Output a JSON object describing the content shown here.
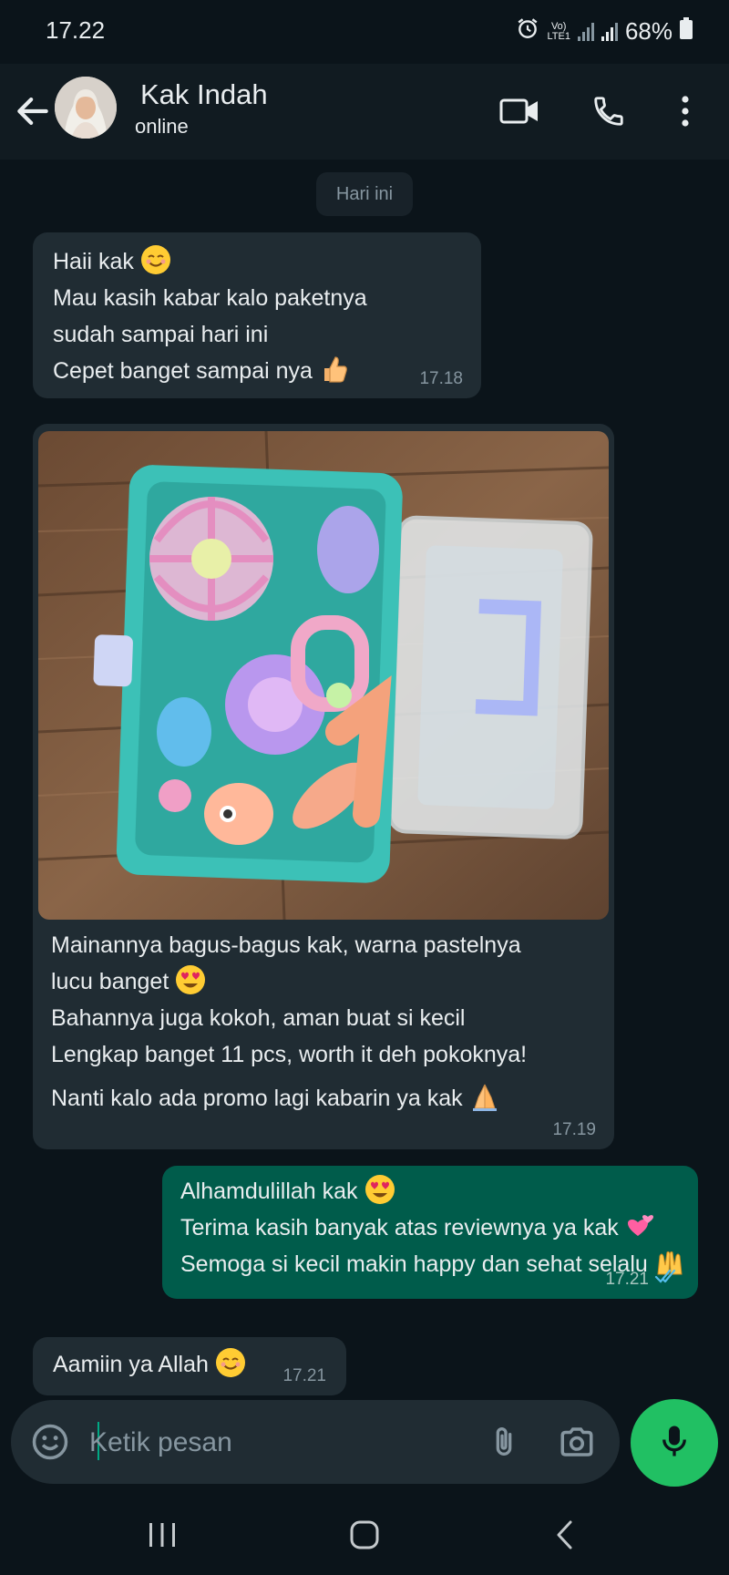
{
  "status_bar": {
    "time": "17.22",
    "network_top": "Vo)",
    "network_bottom": "LTE1",
    "battery": "68%",
    "icons": [
      "alarm-icon",
      "signal-icon",
      "signal-icon",
      "battery-icon"
    ]
  },
  "header": {
    "contact_name": "Kak Indah",
    "status": "online",
    "icons": [
      "back-arrow-icon",
      "avatar",
      "video-call-icon",
      "phone-icon",
      "more-vertical-icon"
    ]
  },
  "chat": {
    "date_chip": "Hari ini",
    "messages": [
      {
        "direction": "incoming",
        "lines": [
          "Haii kak",
          "Mau kasih kabar kalo paketnya",
          "sudah sampai hari ini",
          "Cepet banget sampai nya"
        ],
        "time": "17.18"
      },
      {
        "direction": "incoming",
        "has_photo": true,
        "lines": [
          "Mainannya bagus-bagus kak, warna pastelnya",
          "lucu banget",
          "Bahannya juga kokoh, aman buat si kecil",
          "Lengkap banget 11 pcs, worth it deh pokoknya!",
          "Nanti kalo ada promo lagi kabarin ya kak"
        ],
        "time": "17.19"
      },
      {
        "direction": "outgoing",
        "lines": [
          "Alhamdulillah kak",
          "Terima kasih banyak atas reviewnya ya kak",
          "Semoga si kecil makin happy dan sehat selalu"
        ],
        "time": "17.21",
        "read_receipt": "double-check-icon"
      },
      {
        "direction": "incoming",
        "lines": [
          "Aamiin ya Allah"
        ],
        "time": "17.21"
      }
    ]
  },
  "composer": {
    "placeholder": "Ketik pesan",
    "icons": [
      "emoji-icon",
      "attach-icon",
      "camera-icon",
      "mic-icon"
    ]
  },
  "colors": {
    "background": "#0b141a",
    "header": "#111b21",
    "incoming_bubble": "#202c33",
    "outgoing_bubble": "#005c4b",
    "accent_green": "#21c063"
  }
}
